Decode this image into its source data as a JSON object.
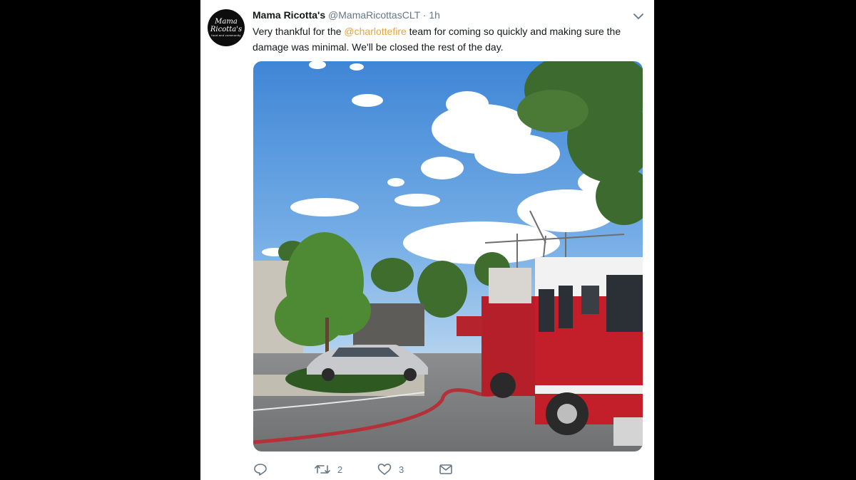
{
  "tweet": {
    "avatar": {
      "line1": "Mama",
      "line2": "Ricotta's",
      "line3": "food and community"
    },
    "display_name": "Mama Ricotta's",
    "handle": "@MamaRicottasCLT",
    "separator": "·",
    "time": "1h",
    "text_before": "Very thankful for the ",
    "mention": "@charlottefire",
    "text_after": " team for coming so quickly and making sure the damage was minimal. We'll be closed the rest of the day.",
    "media_description": "Fire truck and hose outside restaurant parking lot under blue sky",
    "actions": {
      "reply_count": "",
      "retweet_count": "2",
      "like_count": "3"
    }
  },
  "colors": {
    "page_background": "#000000",
    "card_background": "#ffffff",
    "mention": "#e8a33d",
    "muted": "#657786",
    "text": "#14171a"
  },
  "icons": [
    "caret-down-icon",
    "reply-icon",
    "retweet-icon",
    "like-icon",
    "direct-message-icon"
  ]
}
